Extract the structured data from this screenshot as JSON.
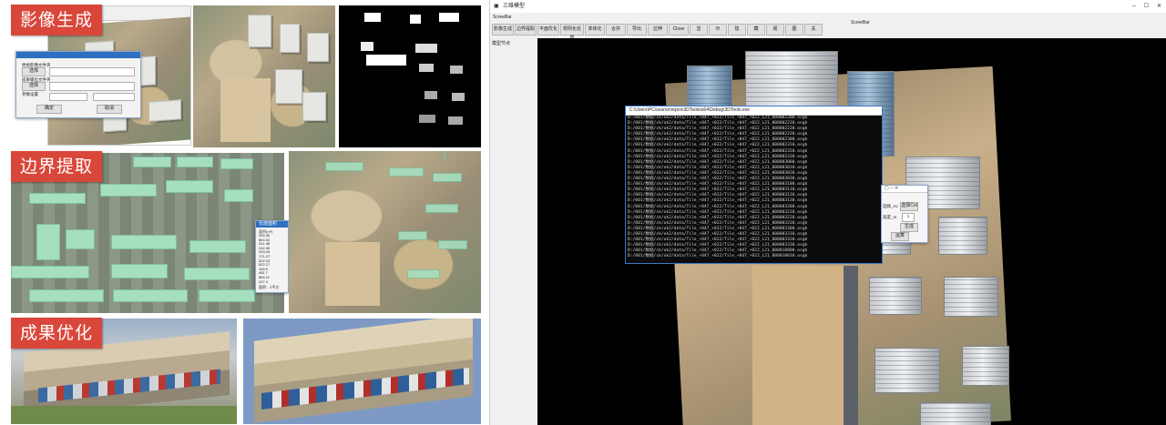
{
  "banners": {
    "generate": "影像生成",
    "boundary": "边界提取",
    "optimize": "成果优化"
  },
  "dialog": {
    "field1_label": "原始影像文件夹",
    "field1_button": "选择",
    "field2_label": "成果输出文件夹",
    "field2_button": "选择",
    "field3_label": "参数设置",
    "confirm": "确定",
    "cancel": "取消"
  },
  "list_window": {
    "title": "长度面积",
    "header": "面积(m²)",
    "values": [
      "254.35",
      "864.32",
      "241.98",
      "242.35",
      "203.26",
      "171.27",
      "522.15",
      "522.17",
      "154.9",
      "481.7",
      "884.11",
      "247.4"
    ],
    "footer": "面积：2平方"
  },
  "app": {
    "window_title": "三维模型",
    "menu_label": "ScreeBar",
    "toolbar_right_label": "ScreeBar",
    "side_label": "模型节点",
    "toolbar": [
      "影像生成",
      "边界提取",
      "平面优化",
      "规则化处理",
      "单体化",
      "合并",
      "导出",
      "拉伸",
      "Close",
      "显",
      "示",
      "隐",
      "藏",
      "视",
      "图",
      "关"
    ],
    "console_title": "C:\\Users\\PC\\source\\repos\\3DTools\\x64\\Debug\\3DTools.exe",
    "console_lines": [
      "D:/001/数据/ck/ok2/data/Tile_+047_+022/Tile_+047_+022_L21_000002200.osgb",
      "D:/001/数据/ck/ok2/data/Tile_+047_+022/Tile_+047_+022_L21_000002210.osgb",
      "D:/001/数据/ck/ok2/data/Tile_+047_+022/Tile_+047_+022_L21_000002220.osgb",
      "D:/001/数据/ck/ok2/data/Tile_+047_+022/Tile_+047_+022_L21_000002230.osgb",
      "D:/001/数据/ck/ok2/data/Tile_+047_+022/Tile_+047_+022_L21_000002300.osgb",
      "D:/001/数据/ck/ok2/data/Tile_+047_+022/Tile_+047_+022_L21_000002310.osgb",
      "D:/001/数据/ck/ok2/data/Tile_+047_+022/Tile_+047_+022_L21_000002320.osgb",
      "D:/001/数据/ck/ok2/data/Tile_+047_+022/Tile_+047_+022_L21_000002330.osgb",
      "D:/001/数据/ck/ok2/data/Tile_+047_+022/Tile_+047_+022_L21_000003000.osgb",
      "D:/001/数据/ck/ok2/data/Tile_+047_+022/Tile_+047_+022_L21_000003010.osgb",
      "D:/001/数据/ck/ok2/data/Tile_+047_+022/Tile_+047_+022_L21_000003020.osgb",
      "D:/001/数据/ck/ok2/data/Tile_+047_+022/Tile_+047_+022_L21_000003030.osgb",
      "D:/001/数据/ck/ok2/data/Tile_+047_+022/Tile_+047_+022_L21_000003100.osgb",
      "D:/001/数据/ck/ok2/data/Tile_+047_+022/Tile_+047_+022_L21_000003110.osgb",
      "D:/001/数据/ck/ok2/data/Tile_+047_+022/Tile_+047_+022_L21_000003120.osgb",
      "D:/001/数据/ck/ok2/data/Tile_+047_+022/Tile_+047_+022_L21_000003130.osgb",
      "D:/001/数据/ck/ok2/data/Tile_+047_+022/Tile_+047_+022_L21_000003200.osgb",
      "D:/001/数据/ck/ok2/data/Tile_+047_+022/Tile_+047_+022_L21_000003210.osgb",
      "D:/001/数据/ck/ok2/data/Tile_+047_+022/Tile_+047_+022_L21_000003220.osgb",
      "D:/001/数据/ck/ok2/data/Tile_+047_+022/Tile_+047_+022_L21_000003230.osgb",
      "D:/001/数据/ck/ok2/data/Tile_+047_+022/Tile_+047_+022_L21_000003300.osgb",
      "D:/001/数据/ck/ok2/data/Tile_+047_+022/Tile_+047_+022_L21_000003310.osgb",
      "D:/001/数据/ck/ok2/data/Tile_+047_+022/Tile_+047_+022_L21_000003320.osgb",
      "D:/001/数据/ck/ok2/data/Tile_+047_+022/Tile_+047_+022_L21_000003330.osgb",
      "D:/001/数据/ck/ok2/data/Tile_+047_+022/Tile_+047_+022_L21_000010000.osgb",
      "D:/001/数据/ck/ok2/data/Tile_+047_+022/Tile_+047_+022_L21_000010010.osgb"
    ],
    "mini_dialog": {
      "label_a": "选择_Ac",
      "button_a": "选择Col",
      "label_b": "高度_m",
      "value_b": "1",
      "button_b": "生成",
      "button_c": "取消",
      "ok": "运算"
    }
  },
  "colors": {
    "banner_red": "#d9473a",
    "footprint_green": "#a6dfc0",
    "title_blue": "#2f6fbf"
  }
}
